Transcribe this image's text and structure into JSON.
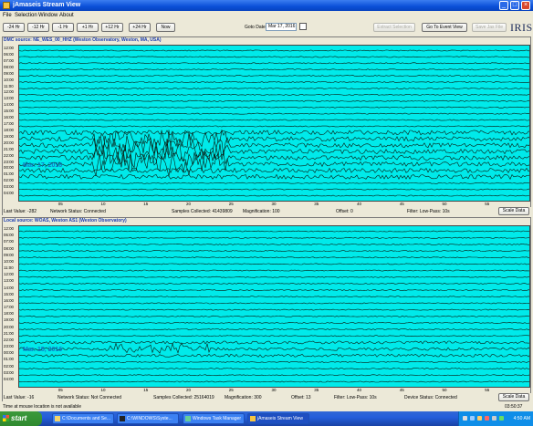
{
  "window": {
    "title": "jAmaseis Stream View",
    "controls": [
      "_",
      "□",
      "×"
    ]
  },
  "menu": [
    "File",
    "Selection",
    "Window",
    "About"
  ],
  "toolbar": {
    "time_buttons": [
      "-24 Hr",
      "-12 Hr",
      "-1 Hr",
      "+1 Hr",
      "+12 Hr",
      "+24 Hr",
      "Now"
    ],
    "goto_label": "Goto Date:",
    "goto_value": "Mar 17, 2016",
    "extract_label": "Extract Selection",
    "event_view_label": "Go To Event View",
    "save_label": "Save Jas File",
    "logo": "IRIS"
  },
  "panels": [
    {
      "title": "DMC source: NE_WES_00_HHZ (Weston Observatory, Weston, MA, USA)",
      "hours": [
        "12:00",
        "06:00",
        "07:00",
        "08:00",
        "09:00",
        "10:00",
        "11:00",
        "12:00",
        "13:00",
        "14:00",
        "15:00",
        "16:00",
        "17:00",
        "18:00",
        "19:00",
        "20:00",
        "21:00",
        "22:00",
        "23:00",
        "00:00",
        "01:00",
        "02:00",
        "03:00",
        "04:00"
      ],
      "minutes": [
        "05",
        "10",
        "15",
        "20",
        "25",
        "30",
        "35",
        "40",
        "45",
        "50",
        "55"
      ],
      "overlay_date": "Mar. 17, 2016",
      "status": {
        "last_value": "Last Value: -282",
        "network": "Network Status: Connected",
        "samples": "Samples Collected: 41439809",
        "magnification": "Magnification: 100",
        "offset": "Offset: 0",
        "filter": "Filter: Low-Pass: 10s"
      },
      "scale_label": "Scale Data"
    },
    {
      "title": "Local source: WOAS, Weston AS1 (Weston Observatory)",
      "hours": [
        "12:00",
        "06:00",
        "07:00",
        "08:00",
        "09:00",
        "10:00",
        "11:00",
        "12:00",
        "13:00",
        "14:00",
        "15:00",
        "16:00",
        "17:00",
        "18:00",
        "19:00",
        "20:00",
        "21:00",
        "22:00",
        "23:00",
        "00:00",
        "01:00",
        "02:00",
        "03:00",
        "04:00"
      ],
      "minutes": [
        "05",
        "10",
        "15",
        "20",
        "25",
        "30",
        "35",
        "40",
        "45",
        "50",
        "55"
      ],
      "overlay_date": "Mar. 15, 2016",
      "status": {
        "last_value": "Last Value: -16",
        "network": "Network Status: Not Connected",
        "samples": "Samples Collected: 25164019",
        "magnification": "Magnification: 300",
        "offset": "Offset: 13",
        "filter": "Filter: Low-Pass: 10s",
        "device": "Device Status: Connected"
      },
      "scale_label": "Scale Data"
    }
  ],
  "bottom_status": {
    "left": "Time at mouse location is not available",
    "right": "03:50:37"
  },
  "taskbar": {
    "start": "start",
    "tasks": [
      "C:\\Documents and Se...",
      "C:\\WINDOWS\\Syste...",
      "Windows Task Manager",
      "jAmaseis Stream View"
    ],
    "clock": "4:50 AM"
  },
  "colors": {
    "plot_bg": "#00eaea",
    "trace": "#0a1a10",
    "title_blue": "#1a3db0",
    "xp_blue": "#245edb"
  }
}
